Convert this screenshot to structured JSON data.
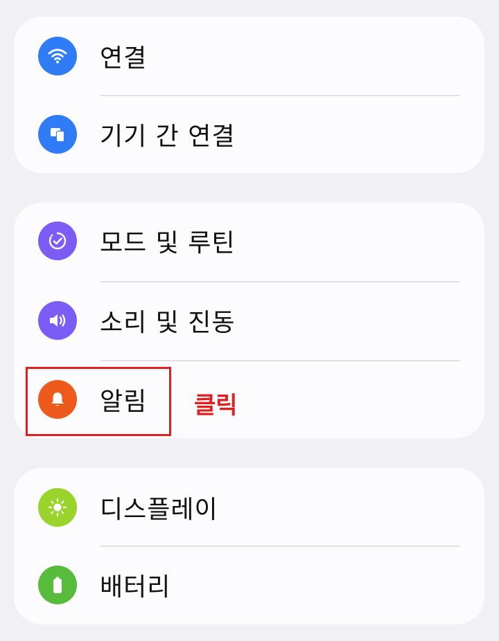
{
  "colors": {
    "background": "#f1f1f4",
    "card": "#fcfcfe",
    "connections": "#2f7cf6",
    "connected_devices": "#2f7cf6",
    "modes_routines": "#7b5cf5",
    "sounds_vibration": "#7b5cf5",
    "notifications": "#ee5a1c",
    "display": "#9bd32d",
    "battery": "#57bb3b",
    "annotation": "#e02020"
  },
  "groups": [
    {
      "items": [
        {
          "label": "연결",
          "icon": "wifi-icon"
        },
        {
          "label": "기기 간 연결",
          "icon": "devices-icon"
        }
      ]
    },
    {
      "items": [
        {
          "label": "모드 및 루틴",
          "icon": "routine-check-icon"
        },
        {
          "label": "소리 및 진동",
          "icon": "speaker-icon"
        },
        {
          "label": "알림",
          "icon": "bell-icon"
        }
      ]
    },
    {
      "items": [
        {
          "label": "디스플레이",
          "icon": "sun-icon"
        },
        {
          "label": "배터리",
          "icon": "battery-icon"
        }
      ]
    }
  ],
  "annotation": {
    "text": "클릭"
  }
}
